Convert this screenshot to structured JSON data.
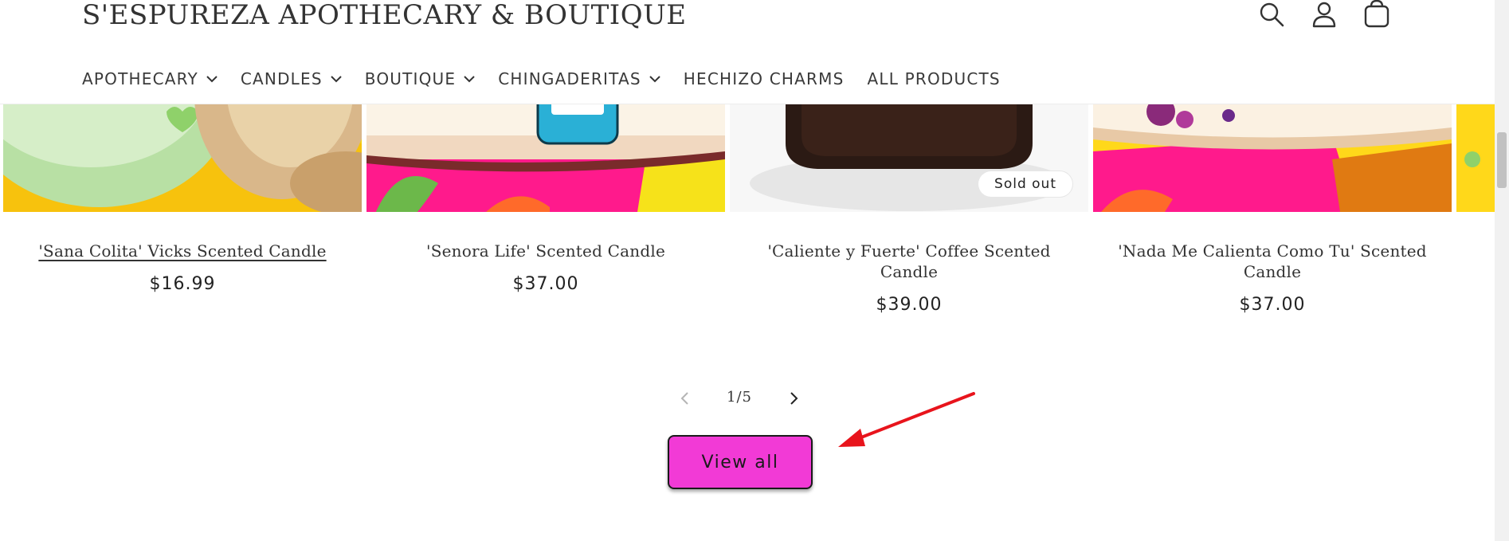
{
  "header": {
    "store_title": "S'ESPUREZA APOTHECARY & BOUTIQUE",
    "icons": [
      "search-icon",
      "account-icon",
      "cart-icon"
    ]
  },
  "nav": {
    "items": [
      {
        "label": "APOTHECARY",
        "has_dropdown": true
      },
      {
        "label": "CANDLES",
        "has_dropdown": true
      },
      {
        "label": "BOUTIQUE",
        "has_dropdown": true
      },
      {
        "label": "CHINGADERITAS",
        "has_dropdown": true
      },
      {
        "label": "HECHIZO CHARMS",
        "has_dropdown": false
      },
      {
        "label": "ALL PRODUCTS",
        "has_dropdown": false
      }
    ]
  },
  "products": [
    {
      "title": "'Sana Colita' Vicks Scented Candle",
      "price": "$16.99",
      "sold_out": false,
      "hovered": true
    },
    {
      "title": "'Senora Life' Scented Candle",
      "price": "$37.00",
      "sold_out": false
    },
    {
      "title": "'Caliente y Fuerte' Coffee Scented Candle",
      "price": "$39.00",
      "sold_out": true,
      "badge": "Sold out"
    },
    {
      "title": "'Nada Me Calienta Como Tu' Scented Candle",
      "price": "$37.00",
      "sold_out": false
    }
  ],
  "pagination": {
    "current": "1/5"
  },
  "view_all": {
    "label": "View all"
  },
  "colors": {
    "accent": "#f23ad6",
    "hot_pink": "#ff1a8c",
    "yellow": "#ffd81a",
    "annotation_red": "#e8141c"
  }
}
